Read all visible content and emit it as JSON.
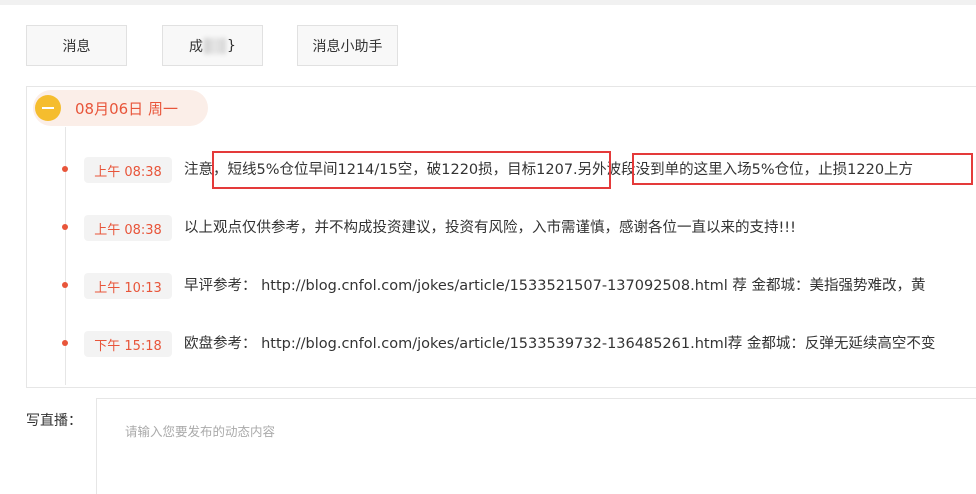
{
  "tabs": [
    {
      "label": "消息"
    },
    {
      "label_prefix": "成",
      "label_suffix": "}"
    },
    {
      "label": "消息小助手"
    }
  ],
  "timeline": {
    "date_label": "08月06日 周一",
    "entries": [
      {
        "time": "上午 08:38",
        "text": "注意，短线5%仓位早间1214/15空，破1220损，目标1207.另外波段没到单的这里入场5%仓位，止损1220上方"
      },
      {
        "time": "上午 08:38",
        "text": "以上观点仅供参考，并不构成投资建议，投资有风险，入市需谨慎，感谢各位一直以来的支持!!!"
      },
      {
        "time": "上午 10:13",
        "text": "早评参考： http://blog.cnfol.com/jokes/article/1533521507-137092508.html 荐 金都城：美指强势难改，黄"
      },
      {
        "time": "下午 15:18",
        "text": "欧盘参考： http://blog.cnfol.com/jokes/article/1533539732-136485261.html荐 金都城：反弹无延续高空不变"
      }
    ]
  },
  "compose": {
    "label": "写直播：",
    "placeholder": "请输入您要发布的动态内容"
  },
  "colors": {
    "accent": "#e8553a",
    "date_dot": "#f5bd2e",
    "highlight_box": "#e43a3a"
  }
}
